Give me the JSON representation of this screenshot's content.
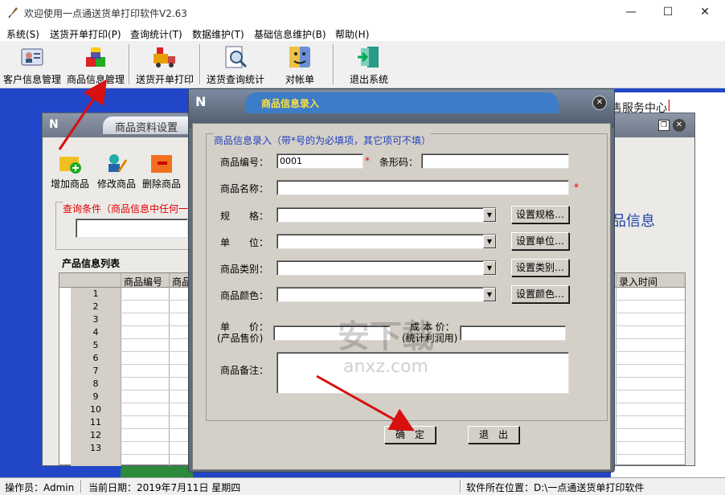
{
  "window": {
    "title": "欢迎使用一点通送货单打印软件V2.63",
    "min": "—",
    "max": "☐",
    "close": "✕"
  },
  "menu": [
    "系统(S)",
    "送货开单打印(P)",
    "查询统计(T)",
    "数据维护(T)",
    "基础信息维护(B)",
    "帮助(H)"
  ],
  "toolbar": [
    "客户信息管理",
    "商品信息管理",
    "送货开单打印",
    "送货查询统计",
    "对帐单",
    "退出系统"
  ],
  "background_text": {
    "service_center": "售服务中心",
    "product_info": "品信息"
  },
  "product_window": {
    "title": "商品资料设置",
    "tools": [
      "增加商品",
      "修改商品",
      "删除商品"
    ],
    "query_label": "查询条件（商品信息中任何一",
    "list_title": "产品信息列表",
    "columns": [
      "商品编号",
      "商品"
    ],
    "last_column": "录入时间",
    "rows": [
      "1",
      "2",
      "3",
      "4",
      "5",
      "6",
      "7",
      "8",
      "9",
      "10",
      "11",
      "12",
      "13"
    ]
  },
  "dialog": {
    "title": "商品信息录入",
    "section": "商品信息录入（带*号的为必填项，其它项可不填）",
    "code_label": "商品编号：",
    "code_value": "0001",
    "barcode_label": "条形码：",
    "name_label": "商品名称：",
    "spec_label": "规　　格：",
    "unit_label": "单　　位：",
    "category_label": "商品类别：",
    "color_label": "商品颜色：",
    "set_spec": "设置规格…",
    "set_unit": "设置单位…",
    "set_category": "设置类别…",
    "set_color": "设置颜色…",
    "price_label_1": "单　　价：",
    "price_label_2": "(产品售价)",
    "cost_label_1": "成 本 价：",
    "cost_label_2": "(统计利润用)",
    "remark_label": "商品备注：",
    "ok": "确　定",
    "exit": "退　出",
    "required": "*"
  },
  "watermark": {
    "cn": "安下载",
    "en": "anxz.com"
  },
  "status": {
    "operator": "操作员：Admin",
    "date": "当前日期：2019年7月11日 星期四",
    "location": "软件所在位置：D:\\一点通送货单打印软件"
  }
}
